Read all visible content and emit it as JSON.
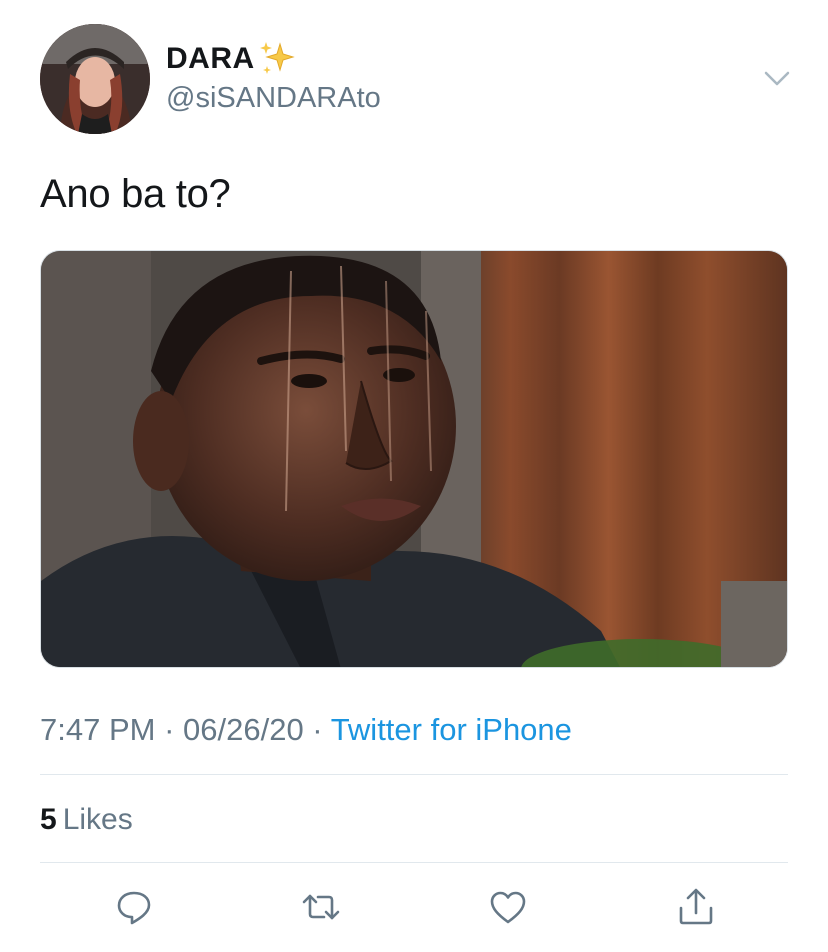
{
  "tweet": {
    "author": {
      "display_name": "DARA",
      "handle": "@siSANDARAto"
    },
    "text": "Ano ba to?",
    "time": "7:47 PM",
    "separator": " · ",
    "date": "06/26/20",
    "source": "Twitter for iPhone",
    "likes_count": "5",
    "likes_label": "Likes"
  },
  "icons": {
    "sparkle": "sparkles-icon",
    "menu": "chevron-down-icon",
    "reply": "reply-icon",
    "retweet": "retweet-icon",
    "like": "heart-icon",
    "share": "share-icon"
  },
  "colors": {
    "text": "#14171a",
    "secondary": "#657786",
    "link": "#1b95e0",
    "divider": "#e1e8ed"
  }
}
